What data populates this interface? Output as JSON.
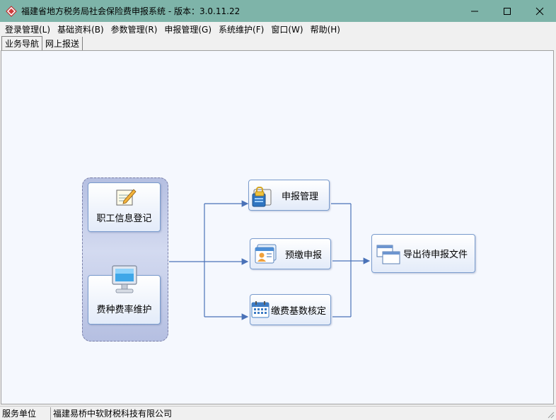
{
  "window": {
    "title": "福建省地方税务局社会保险费申报系统 - 版本：3.0.11.22"
  },
  "menu": [
    {
      "label": "登录管理(L)"
    },
    {
      "label": "基础资料(B)"
    },
    {
      "label": "参数管理(R)"
    },
    {
      "label": "申报管理(G)"
    },
    {
      "label": "系统维护(F)"
    },
    {
      "label": "窗口(W)"
    },
    {
      "label": "帮助(H)"
    }
  ],
  "tabs": [
    {
      "label": "业务导航",
      "active": true
    },
    {
      "label": "网上报送",
      "active": false
    }
  ],
  "flow": {
    "employee_info": "职工信息登记",
    "fee_rate": "费种费率维护",
    "declare_manage": "申报管理",
    "prepay_declare": "预缴申报",
    "base_verify": "缴费基数核定",
    "export_file": "导出待申报文件"
  },
  "status": {
    "label": "服务单位",
    "value": "福建易桥中软财税科技有限公司"
  },
  "colors": {
    "titlebar": "#7eb4a9",
    "canvas": "#f5f8fe",
    "connector": "#4a72b8",
    "node_border": "#7a9ccd"
  },
  "icons": {
    "app": "diamond-logo-icon",
    "minimize": "minimize-icon",
    "maximize": "maximize-icon",
    "close": "close-icon"
  }
}
